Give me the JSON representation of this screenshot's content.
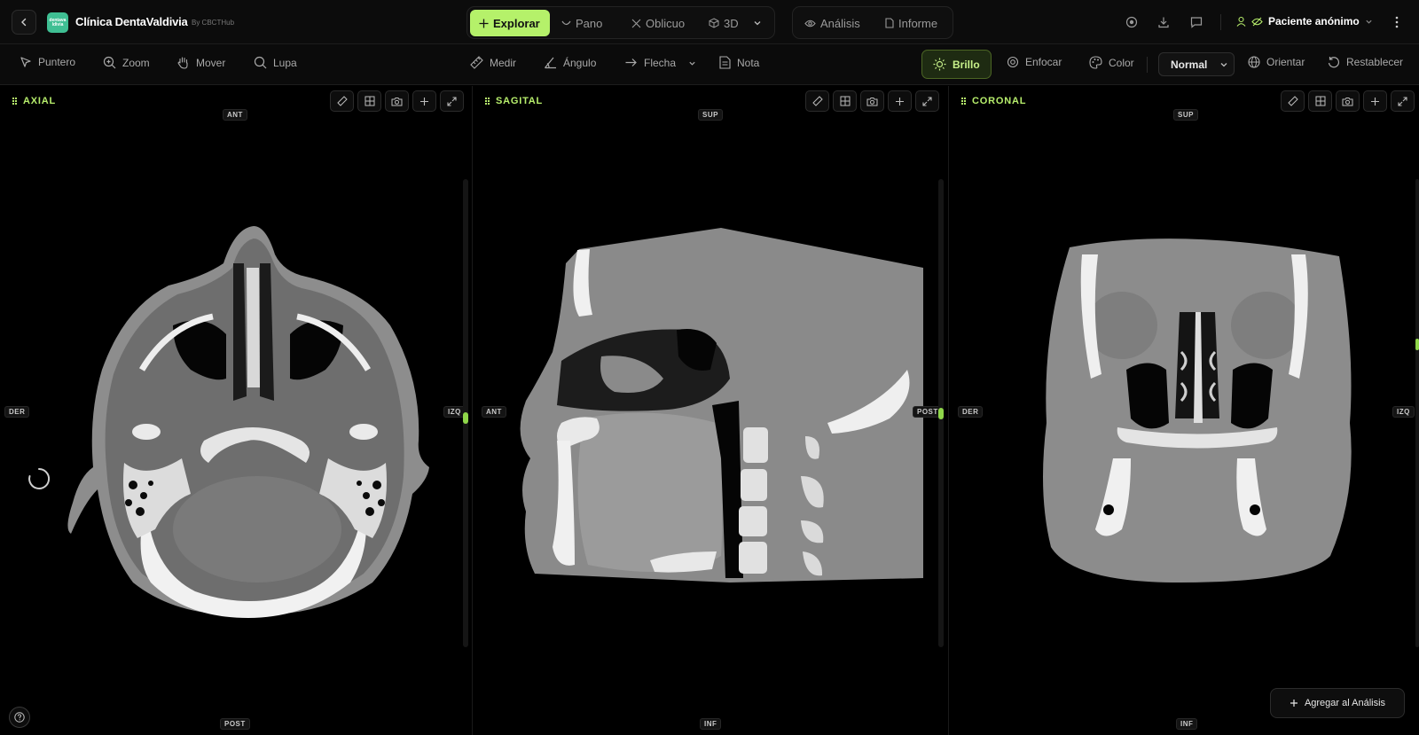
{
  "header": {
    "logo_text": "dentavaldivia",
    "clinic_name": "Clínica DentaValdivia",
    "by_line": "By CBCTHub",
    "nav": [
      {
        "label": "Explorar",
        "active": true
      },
      {
        "label": "Pano"
      },
      {
        "label": "Oblicuo"
      },
      {
        "label": "3D"
      }
    ],
    "secondary_nav": [
      {
        "label": "Análisis"
      },
      {
        "label": "Informe"
      }
    ],
    "patient_label": "Paciente anónimo"
  },
  "toolbar": {
    "left_tools": [
      "Puntero",
      "Zoom",
      "Mover",
      "Lupa"
    ],
    "center_tools": [
      "Medir",
      "Ángulo",
      "Flecha",
      "Nota"
    ],
    "right_tools": [
      "Brillo",
      "Enfocar",
      "Color"
    ],
    "active_tool": "Brillo",
    "blend_mode": "Normal",
    "orient_label": "Orientar",
    "reset_label": "Restablecer"
  },
  "panels": [
    {
      "title": "AXIAL",
      "top": "ANT",
      "bottom": "POST",
      "left": "DER",
      "right": "IZQ",
      "slice_position": 0.51
    },
    {
      "title": "SAGITAL",
      "top": "SUP",
      "bottom": "INF",
      "left": "ANT",
      "right": "POST",
      "slice_position": 0.5
    },
    {
      "title": "CORONAL",
      "top": "SUP",
      "bottom": "INF",
      "left": "DER",
      "right": "IZQ",
      "slice_position": 0.35
    }
  ],
  "footer": {
    "add_to_analysis": "Agregar al Análisis"
  },
  "colors": {
    "accent": "#b5f16a",
    "accent_text": "#b7ee6c",
    "background": "#000000",
    "panel_border": "#1a1a1a"
  }
}
